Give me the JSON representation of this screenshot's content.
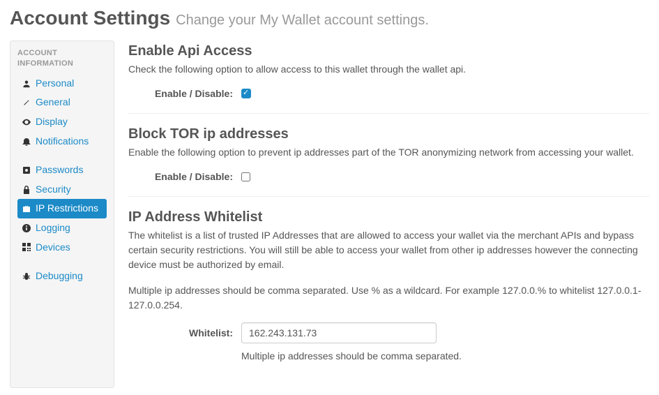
{
  "header": {
    "title": "Account Settings",
    "subtitle": "Change your My Wallet account settings."
  },
  "sidebar": {
    "heading": "ACCOUNT INFORMATION",
    "groups": [
      {
        "items": [
          {
            "label": "Personal",
            "icon": "person-icon",
            "active": false
          },
          {
            "label": "General",
            "icon": "wrench-icon",
            "active": false
          },
          {
            "label": "Display",
            "icon": "eye-icon",
            "active": false
          },
          {
            "label": "Notifications",
            "icon": "bell-icon",
            "active": false
          }
        ]
      },
      {
        "items": [
          {
            "label": "Passwords",
            "icon": "vault-icon",
            "active": false
          },
          {
            "label": "Security",
            "icon": "lock-icon",
            "active": false
          },
          {
            "label": "IP Restrictions",
            "icon": "briefcase-icon",
            "active": true
          },
          {
            "label": "Logging",
            "icon": "info-icon",
            "active": false
          },
          {
            "label": "Devices",
            "icon": "qrcode-icon",
            "active": false
          }
        ]
      },
      {
        "items": [
          {
            "label": "Debugging",
            "icon": "bug-icon",
            "active": false
          }
        ]
      }
    ]
  },
  "sections": {
    "api": {
      "title": "Enable Api Access",
      "desc": "Check the following option to allow access to this wallet through the wallet api.",
      "toggle_label": "Enable / Disable:",
      "checked": true
    },
    "tor": {
      "title": "Block TOR ip addresses",
      "desc": "Enable the following option to prevent ip addresses part of the TOR anonymizing network from accessing your wallet.",
      "toggle_label": "Enable / Disable:",
      "checked": false
    },
    "whitelist": {
      "title": "IP Address Whitelist",
      "desc": "The whitelist is a list of trusted IP Addresses that are allowed to access your wallet via the merchant APIs and bypass certain security restrictions. You will still be able to access your wallet from other ip addresses however the connecting device must be authorized by email.",
      "desc2": "Multiple ip addresses should be comma separated. Use % as a wildcard. For example 127.0.0.% to whitelist 127.0.0.1-127.0.0.254.",
      "field_label": "Whitelist:",
      "value": "162.243.131.73",
      "hint": "Multiple ip addresses should be comma separated."
    }
  }
}
